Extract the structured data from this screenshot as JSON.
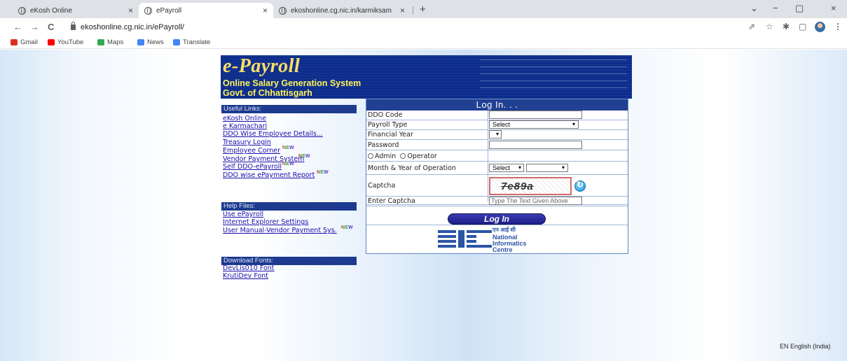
{
  "browser": {
    "tabs": [
      {
        "title": "eKosh Online",
        "close": "×",
        "active": false
      },
      {
        "title": "ePayroll",
        "close": "×",
        "active": true
      },
      {
        "title": "ekoshonline.cg.nic.in/karmiksam",
        "close": "×",
        "active": false
      }
    ],
    "new_tab": "+",
    "window_controls": {
      "menu": "⌄",
      "minimize": "−",
      "restore": "▢",
      "close": "×"
    },
    "nav": {
      "back": "←",
      "forward": "→",
      "reload": "C"
    },
    "url": "ekoshonline.cg.nic.in/ePayroll/",
    "toolbar_icons": {
      "share": "⇗",
      "star": "☆",
      "extensions": "✱",
      "sidepanel": "▢",
      "menu": "⋮"
    },
    "bookmarks": [
      {
        "label": "Gmail",
        "color": "#d93025"
      },
      {
        "label": "YouTube",
        "color": "#ff0000"
      },
      {
        "label": "Maps",
        "color": "#34a853"
      },
      {
        "label": "News",
        "color": "#4285f4"
      },
      {
        "label": "Translate",
        "color": "#4285f4"
      }
    ]
  },
  "banner": {
    "title": "e-Payroll",
    "subtitle1": "Online Salary Generation System",
    "subtitle2": "Govt. of Chhattisgarh"
  },
  "sidebar": {
    "useful_links_heading": "Useful Links:",
    "useful_links": [
      {
        "label": "eKosh Online",
        "new": false
      },
      {
        "label": "e Karmachari",
        "new": false
      },
      {
        "label": "DDO Wise Employee Details...",
        "new": false
      },
      {
        "label": "Treasury Login",
        "new": false
      },
      {
        "label": "Employee Corner",
        "new": true
      },
      {
        "label": "Vendor Payment System",
        "new": true
      },
      {
        "label": "Self DDO-ePayroll",
        "new": true
      },
      {
        "label": "DDO wise ePayment Report",
        "new": true
      }
    ],
    "help_heading": "Help Files:",
    "help_links": [
      {
        "label": "Use ePayroll",
        "new": false
      },
      {
        "label": "Internet Explorer Settings",
        "new": false
      },
      {
        "label": "User Manual-Vendor Payment Sys.",
        "new": true
      }
    ],
    "fonts_heading": "Download Fonts:",
    "font_links": [
      {
        "label": "DevLis010 Font"
      },
      {
        "label": "KrutiDev Font"
      }
    ],
    "new_badge": "NEW"
  },
  "login": {
    "heading": "Log In. . .",
    "ddo_code_label": "DDO Code",
    "ddo_code_value": "",
    "payroll_type_label": "Payroll Type",
    "payroll_type_value": "Select",
    "financial_year_label": "Financial Year",
    "financial_year_value": "",
    "password_label": "Password",
    "password_value": "",
    "radio_admin": "Admin",
    "radio_operator": "Operator",
    "month_year_label": "Month & Year of Operation",
    "month_value": "Select",
    "year_value": "",
    "captcha_label": "Captcha",
    "captcha_text": "7e89a",
    "enter_captcha_label": "Enter Captcha",
    "enter_captcha_placeholder": "Type The Text Given Above",
    "login_button": "Log In",
    "nic_hindi": "एन आई सी",
    "nic_line1": "National",
    "nic_line2": "Informatics",
    "nic_line3": "Centre"
  },
  "status": {
    "language": "EN English (India)"
  }
}
